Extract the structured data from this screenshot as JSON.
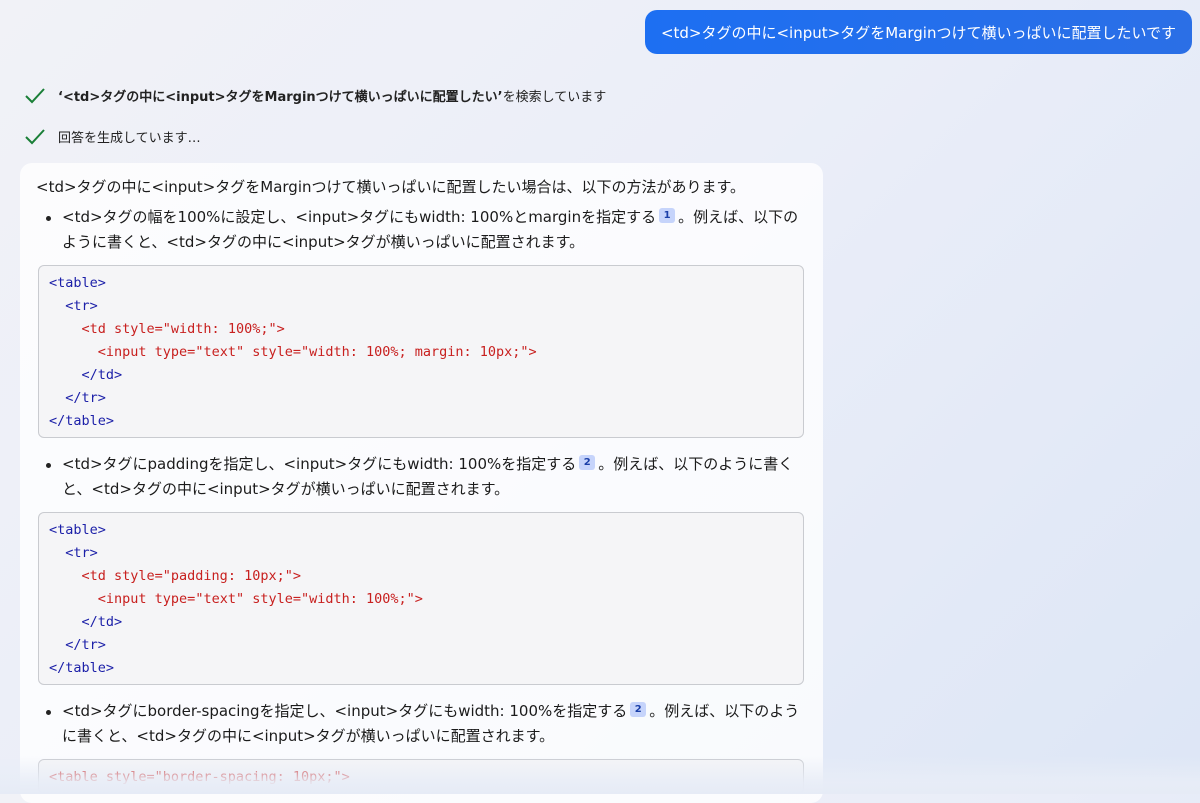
{
  "user_message": "<td>タグの中に<input>タグをMarginつけて横いっぱいに配置したいです",
  "status": {
    "search_query": "‘<td>タグの中に<input>タグをMarginつけて横いっぱいに配置したい’",
    "search_suffix": " を検索しています",
    "generating": "回答を生成しています…"
  },
  "answer": {
    "intro": "<td>タグの中に<input>タグをMarginつけて横いっぱいに配置したい場合は、以下の方法があります。",
    "items": [
      {
        "text_before": "<td>タグの幅を100%に設定し、<input>タグにもwidth: 100%とmarginを指定する",
        "cite": "1",
        "text_after": "。例えば、以下のように書くと、<td>タグの中に<input>タグが横いっぱいに配置されます。",
        "code": [
          "<table>",
          "<tr>",
          "<td style=\"width: 100%;\">",
          "<input type=\"text\" style=\"width: 100%; margin: 10px;\">",
          "</td>",
          "</tr>",
          "</table>"
        ]
      },
      {
        "text_before": "<td>タグにpaddingを指定し、<input>タグにもwidth: 100%を指定する",
        "cite": "2",
        "text_after": "。例えば、以下のように書くと、<td>タグの中に<input>タグが横いっぱいに配置されます。",
        "code": [
          "<table>",
          "<tr>",
          "<td style=\"padding: 10px;\">",
          "<input type=\"text\" style=\"width: 100%;\">",
          "</td>",
          "</tr>",
          "</table>"
        ]
      },
      {
        "text_before": "<td>タグにborder-spacingを指定し、<input>タグにもwidth: 100%を指定する",
        "cite": "2",
        "text_after": "。例えば、以下のように書くと、<td>タグの中に<input>タグが横いっぱいに配置されます。",
        "code": [
          "<table style=\"border-spacing: 10px;\">"
        ]
      }
    ]
  },
  "colors": {
    "user_bubble": "#1d6ff2",
    "check": "#1a7f37",
    "code_tag": "#1b1fa8",
    "code_attr": "#c8201f",
    "cite_bg": "#c6d4fb"
  },
  "icons": {
    "status": "checkmark-icon"
  }
}
